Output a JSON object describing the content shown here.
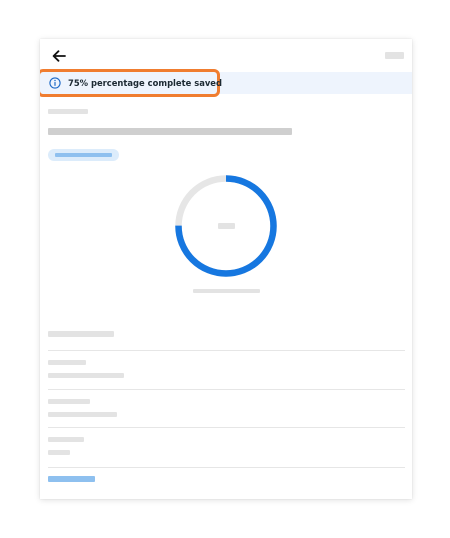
{
  "banner": {
    "message": "75% percentage complete saved",
    "icon": "info-icon"
  },
  "header": {
    "back_icon": "arrow-left-icon"
  },
  "progress": {
    "percent": 75
  },
  "colors": {
    "accent": "#1677e0",
    "track": "#e6e6e6",
    "highlight_outline": "#f07d30",
    "banner_background": "#eef4fd"
  }
}
